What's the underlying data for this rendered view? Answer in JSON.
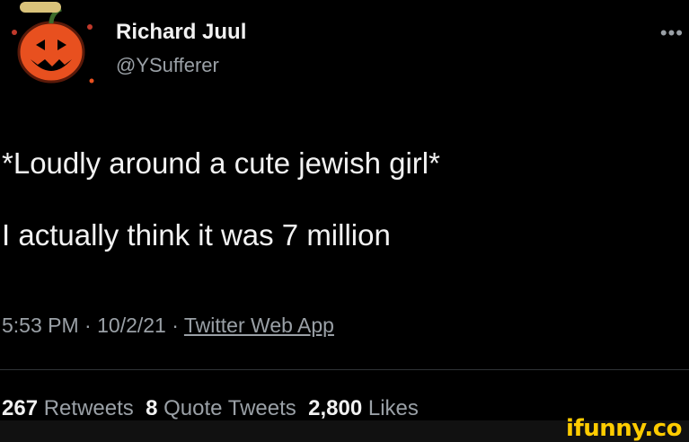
{
  "tweet": {
    "author_name": "Richard Juul",
    "author_handle": "@YSufferer",
    "more_icon": "more-horizontal-icon",
    "text_line1": "*Loudly around a cute jewish girl*",
    "text_line2": "I actually think it was 7 million",
    "time": "5:53 PM",
    "date": "10/2/21",
    "separator": "·",
    "source": "Twitter Web App"
  },
  "stats": {
    "retweets_count": "267",
    "retweets_label": "Retweets",
    "quotes_count": "8",
    "quotes_label": "Quote Tweets",
    "likes_count": "2,800",
    "likes_label": "Likes"
  },
  "watermark": "ifunny.co"
}
